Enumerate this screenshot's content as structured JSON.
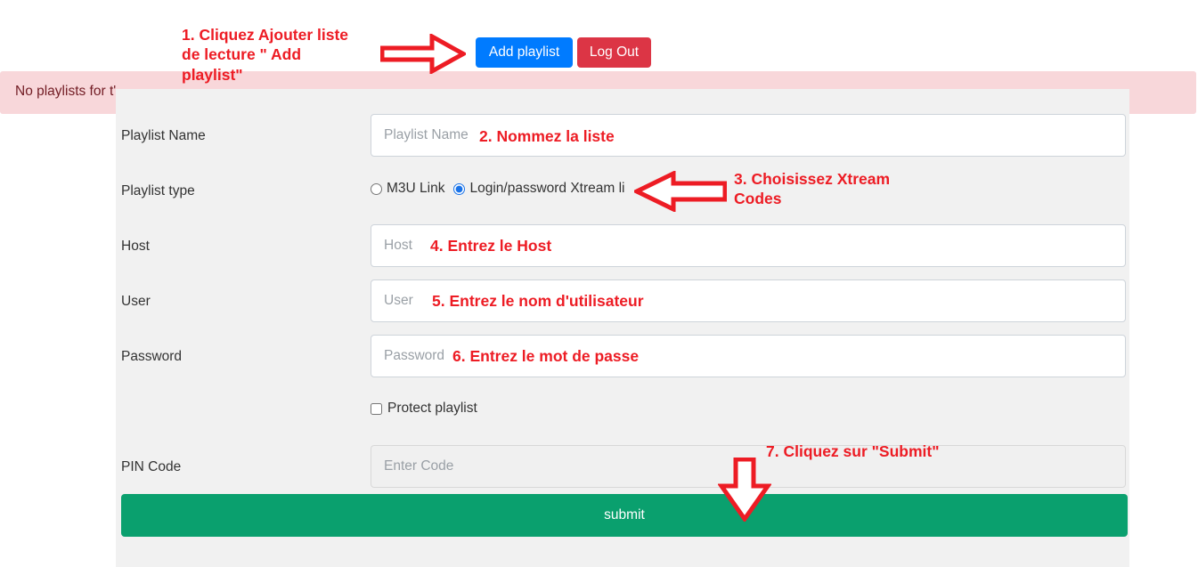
{
  "topbar": {
    "add_playlist_label": "Add playlist",
    "logout_label": "Log Out"
  },
  "alert": {
    "text": "No playlists for t'"
  },
  "form": {
    "fields": [
      {
        "label": "Playlist Name",
        "placeholder": "Playlist Name",
        "value": ""
      },
      {
        "label": "Playlist type"
      },
      {
        "label": "Host",
        "placeholder": "Host",
        "value": ""
      },
      {
        "label": "User",
        "placeholder": "User",
        "value": ""
      },
      {
        "label": "Password",
        "placeholder": "Password",
        "value": ""
      },
      {
        "label": "PIN Code",
        "placeholder": "Enter Code",
        "value": ""
      }
    ],
    "radios": [
      {
        "label": "M3U Link",
        "checked": false
      },
      {
        "label": "Login/password Xtream li",
        "checked": true
      }
    ],
    "protect_checkbox": {
      "label": "Protect playlist",
      "checked": false
    },
    "submit_label": "submit"
  },
  "annotations": [
    {
      "id": "step1",
      "text": "1. Cliquez Ajouter liste\nde lecture \" Add\nplaylist\""
    },
    {
      "id": "step2",
      "text": "2. Nommez la liste"
    },
    {
      "id": "step3",
      "text": "3. Choisissez Xtream\nCodes"
    },
    {
      "id": "step4",
      "text": "4. Entrez le Host"
    },
    {
      "id": "step5",
      "text": "5. Entrez le nom d'utilisateur"
    },
    {
      "id": "step6",
      "text": "6. Entrez le mot de passe"
    },
    {
      "id": "step7",
      "text": "7. Cliquez sur \"Submit\""
    }
  ],
  "colors": {
    "accent_blue": "#007bff",
    "danger_red": "#dc3545",
    "annotation_red": "#ed1c24",
    "submit_green": "#0aa06e",
    "alert_pink": "#f8d7da",
    "panel_grey": "#f1f1f1"
  }
}
